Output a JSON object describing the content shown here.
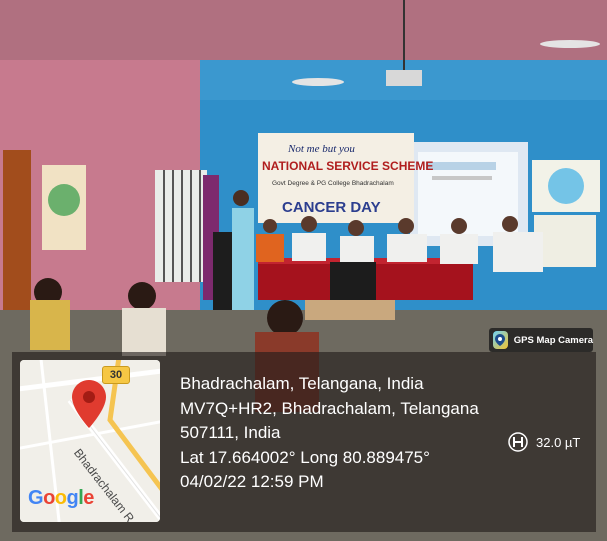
{
  "photo": {
    "banner_line1": "Not me but you",
    "banner_line2": "NATIONAL SERVICE SCHEME",
    "banner_line3": "Govt Degree & PG College Bhadrachalam",
    "banner_line4": "CANCER DAY"
  },
  "badge": {
    "label": "GPS Map Camera",
    "icon": "gps-map-camera-icon"
  },
  "map": {
    "road_number": "30",
    "road_name": "Bhadrachalam R",
    "logo": "Google",
    "pin_icon": "map-pin-icon",
    "pin_color": "#e03b2f"
  },
  "location": {
    "place": "Bhadrachalam, Telangana, India",
    "address_line1": "MV7Q+HR2, Bhadrachalam, Telangana",
    "address_line2": "507111, India",
    "coordinates": "Lat 17.664002° Long 80.889475°",
    "datetime": "04/02/22 12:59 PM"
  },
  "sensor": {
    "icon": "magnetic-field-icon",
    "value": "32.0 µT"
  }
}
